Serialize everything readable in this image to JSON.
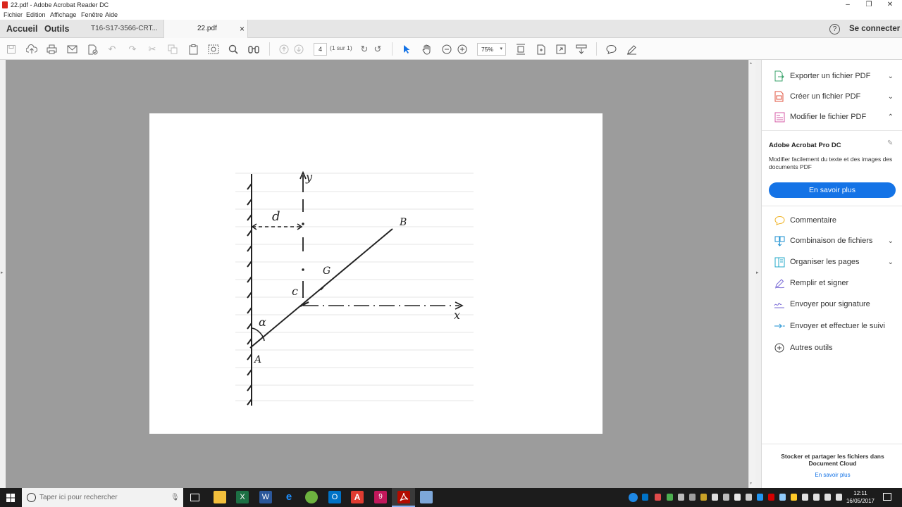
{
  "window": {
    "title": "22.pdf - Adobe Acrobat Reader DC",
    "min": "–",
    "max": "❐",
    "close": "✕"
  },
  "menu": [
    "Fichier",
    "Edition",
    "Affichage",
    "Fenêtre",
    "Aide"
  ],
  "tabs": {
    "home": "Accueil",
    "tools": "Outils",
    "doc1": "T16-S17-3566-CRT...",
    "doc2": "22.pdf",
    "close": "×",
    "help": "?",
    "signin": "Se connecter"
  },
  "toolbar": {
    "page_current": "4",
    "page_total": "(1 sur 1)",
    "zoom": "75%"
  },
  "figure": {
    "label_y": "y",
    "label_x": "x",
    "label_d": "d",
    "label_B": "B",
    "label_G": "G",
    "label_c": "c",
    "label_alpha": "α",
    "label_A": "A"
  },
  "pane": {
    "tools_top": [
      {
        "label": "Exporter un fichier PDF",
        "icon": "export-pdf-icon",
        "chevron": "⌄"
      },
      {
        "label": "Créer un fichier PDF",
        "icon": "create-pdf-icon",
        "chevron": "⌄"
      },
      {
        "label": "Modifier le fichier PDF",
        "icon": "edit-pdf-icon",
        "chevron": "⌃"
      }
    ],
    "promo": {
      "title": "Adobe Acrobat Pro DC",
      "text": "Modifier facilement du texte et des images des documents PDF",
      "button": "En savoir plus"
    },
    "tools_bottom": [
      {
        "label": "Commentaire",
        "icon": "comment-icon"
      },
      {
        "label": "Combinaison de fichiers",
        "icon": "combine-icon",
        "chevron": "⌄"
      },
      {
        "label": "Organiser les pages",
        "icon": "organize-icon",
        "chevron": "⌄"
      },
      {
        "label": "Remplir et signer",
        "icon": "fill-sign-icon"
      },
      {
        "label": "Envoyer pour signature",
        "icon": "send-signature-icon"
      },
      {
        "label": "Envoyer et effectuer le suivi",
        "icon": "send-track-icon"
      },
      {
        "label": "Autres outils",
        "icon": "more-tools-icon"
      }
    ],
    "cloud": {
      "title": "Stocker et partager les fichiers dans Document Cloud",
      "link": "En savoir plus"
    }
  },
  "taskbar": {
    "search_placeholder": "Taper ici pour rechercher",
    "time": "12:11",
    "date": "16/05/2017"
  },
  "colors": {
    "accent": "#1473e6",
    "pdf_red": "#d9261c",
    "doc_bg": "#9c9c9c"
  }
}
